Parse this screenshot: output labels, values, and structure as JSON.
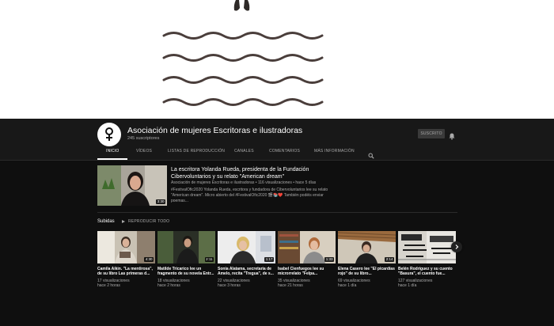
{
  "channel": {
    "name": "Asociación de mujeres Escritoras e ilustradoras",
    "subscribers": "245 suscriptores",
    "subscribe_label": "SUSCRITO"
  },
  "tabs": [
    {
      "label": "INICIO",
      "active": true
    },
    {
      "label": "VÍDEOS",
      "active": false
    },
    {
      "label": "LISTAS DE REPRODUCCIÓN",
      "active": false
    },
    {
      "label": "CANALES",
      "active": false
    },
    {
      "label": "COMENTARIOS",
      "active": false
    },
    {
      "label": "MÁS INFORMACIÓN",
      "active": false
    }
  ],
  "featured": {
    "title": "La escritora Yolanda Rueda, presidenta de la Fundación Cibervoluntarios y su relato \"American dream\"",
    "meta": "Asociación de mujeres Escritoras e ilustradoras • 116 visualizaciones • hace 5 días",
    "description": "#FestivalOfic2020 Yolanda Rueda, escritora y fundadora de Cibervoluntarios lee su relato \"American dream\". Micro abierto del #FestivalOfic2020 🎬📚❤️ También podéis enviar poemas...",
    "duration": "3:30"
  },
  "shelf": {
    "title": "Subidas",
    "play_all": "REPRODUCIR TODO"
  },
  "videos": [
    {
      "title": "Camila Aikin. \"La mentirosa\", de su libro Las primeras d...",
      "views": "17 visualizaciones",
      "time": "hace 2 horas",
      "duration": "4:30"
    },
    {
      "title": "Matilde Tricarico lee un fragmento de su novela Entr...",
      "views": "18 visualizaciones",
      "time": "hace 2 horas",
      "duration": "2:11"
    },
    {
      "title": "Sonia Alatama, secretaria de Amelo, recita \"Tregua\", de s...",
      "views": "22 visualizaciones",
      "time": "hace 3 horas",
      "duration": "1:17"
    },
    {
      "title": "Isabel Cienfuegos lee su microrrelato \"Felpa...",
      "views": "35 visualizaciones",
      "time": "hace 21 horas",
      "duration": "1:33"
    },
    {
      "title": "Elena Casero lee \"El picardías rojo\" de su libro...",
      "views": "69 visualizaciones",
      "time": "hace 1 día",
      "duration": "2:14"
    },
    {
      "title": "Belén Rodríguez y su cuento \"Basura\", el cuento fue...",
      "views": "127 visualizaciones",
      "time": "hace 1 día",
      "duration": ""
    }
  ],
  "colors": {
    "background": "#0f0f0f",
    "header": "#181818",
    "text_secondary": "#aaaaaa"
  },
  "icons": [
    "search-icon",
    "bell-icon",
    "play-all-icon",
    "chevron-right-icon"
  ]
}
